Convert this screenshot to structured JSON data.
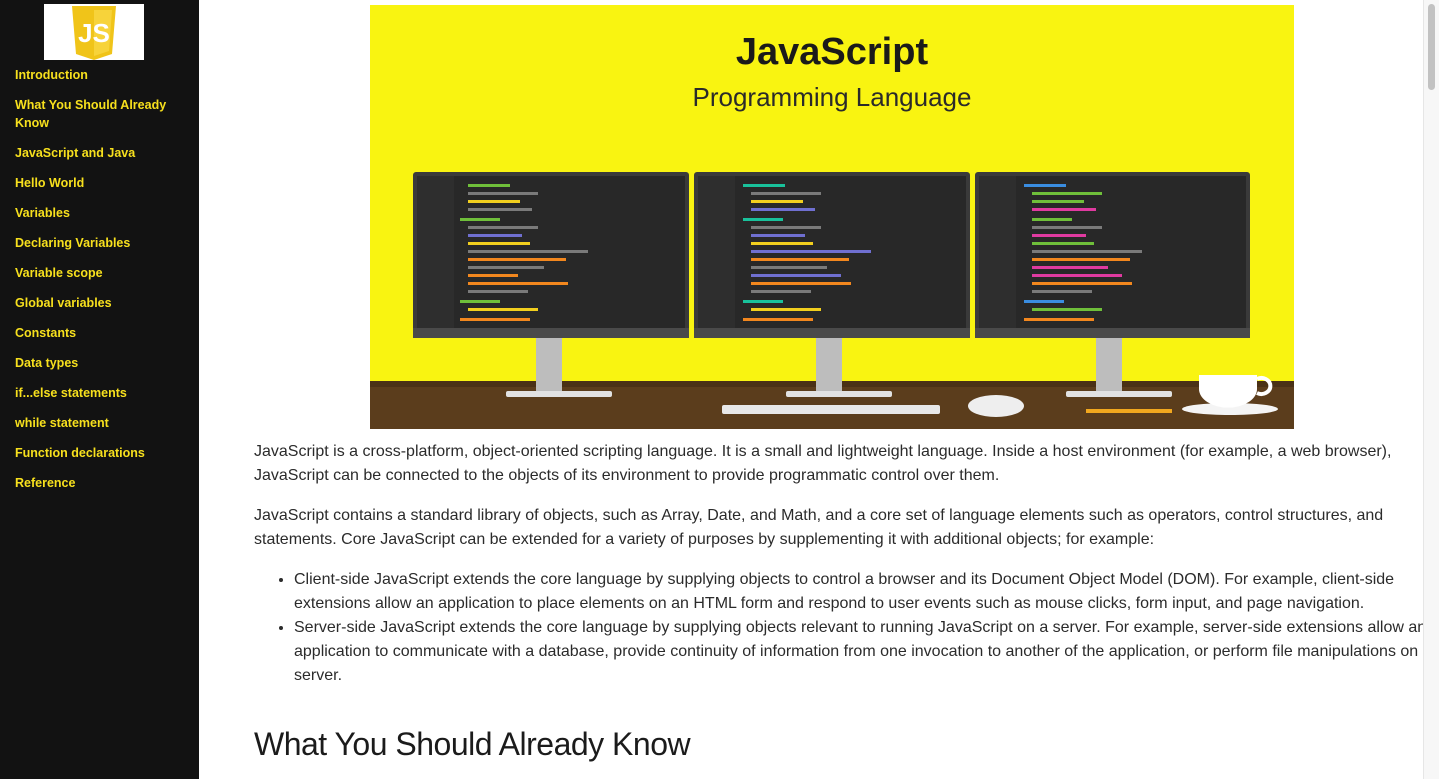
{
  "sidebar": {
    "logo_text": "JS",
    "items": [
      {
        "label": "Introduction"
      },
      {
        "label": "What You Should Already Know"
      },
      {
        "label": "JavaScript and Java"
      },
      {
        "label": "Hello World"
      },
      {
        "label": "Variables"
      },
      {
        "label": "Declaring Variables"
      },
      {
        "label": "Variable scope"
      },
      {
        "label": "Global variables"
      },
      {
        "label": "Constants"
      },
      {
        "label": "Data types"
      },
      {
        "label": "if...else statements"
      },
      {
        "label": "while statement"
      },
      {
        "label": "Function declarations"
      },
      {
        "label": "Reference"
      }
    ]
  },
  "hero": {
    "title": "JavaScript",
    "subtitle": "Programming Language"
  },
  "main": {
    "paragraph_1": "JavaScript is a cross-platform, object-oriented scripting language. It is a small and lightweight language. Inside a host environment (for example, a web browser), JavaScript can be connected to the objects of its environment to provide programmatic control over them.",
    "paragraph_2": "JavaScript contains a standard library of objects, such as Array, Date, and Math, and a core set of language elements such as operators, control structures, and statements. Core JavaScript can be extended for a variety of purposes by supplementing it with additional objects; for example:",
    "bullets": [
      "Client-side JavaScript extends the core language by supplying objects to control a browser and its Document Object Model (DOM). For example, client-side extensions allow an application to place elements on an HTML form and respond to user events such as mouse clicks, form input, and page navigation.",
      "Server-side JavaScript extends the core language by supplying objects relevant to running JavaScript on a server. For example, server-side extensions allow an application to communicate with a database, provide continuity of information from one invocation to another of the application, or perform file manipulations on a server."
    ],
    "section_heading": "What You Should Already Know"
  },
  "colors": {
    "sidebar_bg": "#121212",
    "nav_link": "#f7e01d",
    "hero_bg": "#f9f411",
    "desk": "#5b3d1c"
  }
}
